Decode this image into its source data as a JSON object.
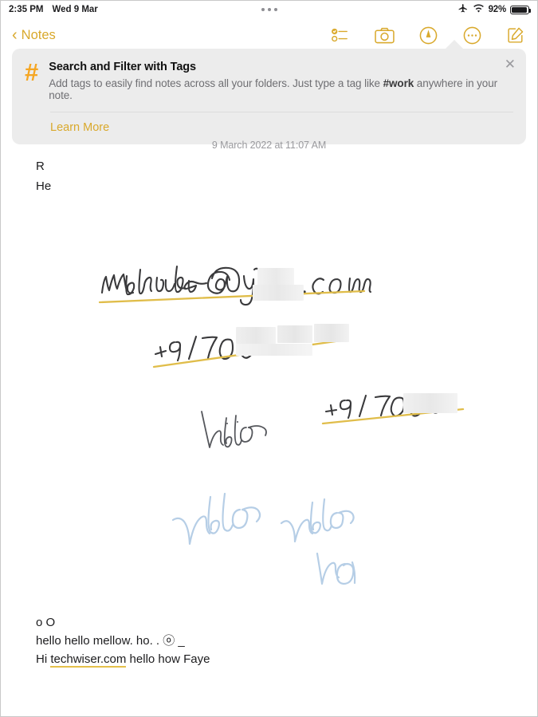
{
  "status_bar": {
    "time": "2:35 PM",
    "date": "Wed 9 Mar",
    "battery_percent": "92%",
    "icons": [
      "airplane-mode-icon",
      "wifi-icon",
      "battery-icon"
    ],
    "multitask_handle": "multitask-handle-dots"
  },
  "navbar": {
    "back_label": "Notes",
    "back_chevron": "‹",
    "actions": [
      {
        "name": "checklist-icon",
        "title": "Checklist"
      },
      {
        "name": "camera-icon",
        "title": "Camera"
      },
      {
        "name": "markup-pen-icon",
        "title": "Markup"
      },
      {
        "name": "more-ellipsis-icon",
        "title": "More"
      },
      {
        "name": "compose-icon",
        "title": "New Note"
      }
    ]
  },
  "banner": {
    "icon": "hashtag-icon",
    "title": "Search and Filter with Tags",
    "body_before": "Add tags to easily find notes across all your folders. Just type a tag like ",
    "body_bold": "#work",
    "body_after": " anywhere in your note.",
    "learn_more": "Learn More",
    "close_icon": "close-icon",
    "accent_color": "#f5a623",
    "link_color": "#d9a92c",
    "background_color": "#ececec"
  },
  "note": {
    "date_stamp": "9 March 2022 at 11:07 AM",
    "top_lines": [
      "R",
      "He"
    ],
    "bottom_lines": [
      {
        "text": "o O"
      },
      {
        "text": "hello hello mellow. ho. . ⓞ _"
      }
    ],
    "bottom_link_line": {
      "prefix": "Hi ",
      "link": "techwiser.com",
      "suffix": " hello how Faye"
    },
    "handwriting": [
      {
        "name": "handwritten-email",
        "text": "mehwrish@y███.com",
        "color": "#3a3a3c",
        "underline_color": "#e0bd4a"
      },
      {
        "name": "handwritten-phone-1",
        "text": "+91 700██████",
        "color": "#3a3a3c",
        "underline_color": "#e0bd4a"
      },
      {
        "name": "handwritten-phone-2",
        "text": "+91 7006████",
        "color": "#3a3a3c",
        "underline_color": "#e0bd4a"
      },
      {
        "name": "handwritten-hello-gray",
        "text": "hello",
        "color": "#55575c"
      },
      {
        "name": "handwritten-hello-blue-1",
        "text": "hello",
        "color": "#b6cee6"
      },
      {
        "name": "handwritten-hello-blue-2",
        "text": "hello",
        "color": "#b6cee6"
      },
      {
        "name": "handwritten-ho-blue",
        "text": "ho",
        "color": "#b6cee6"
      }
    ]
  }
}
